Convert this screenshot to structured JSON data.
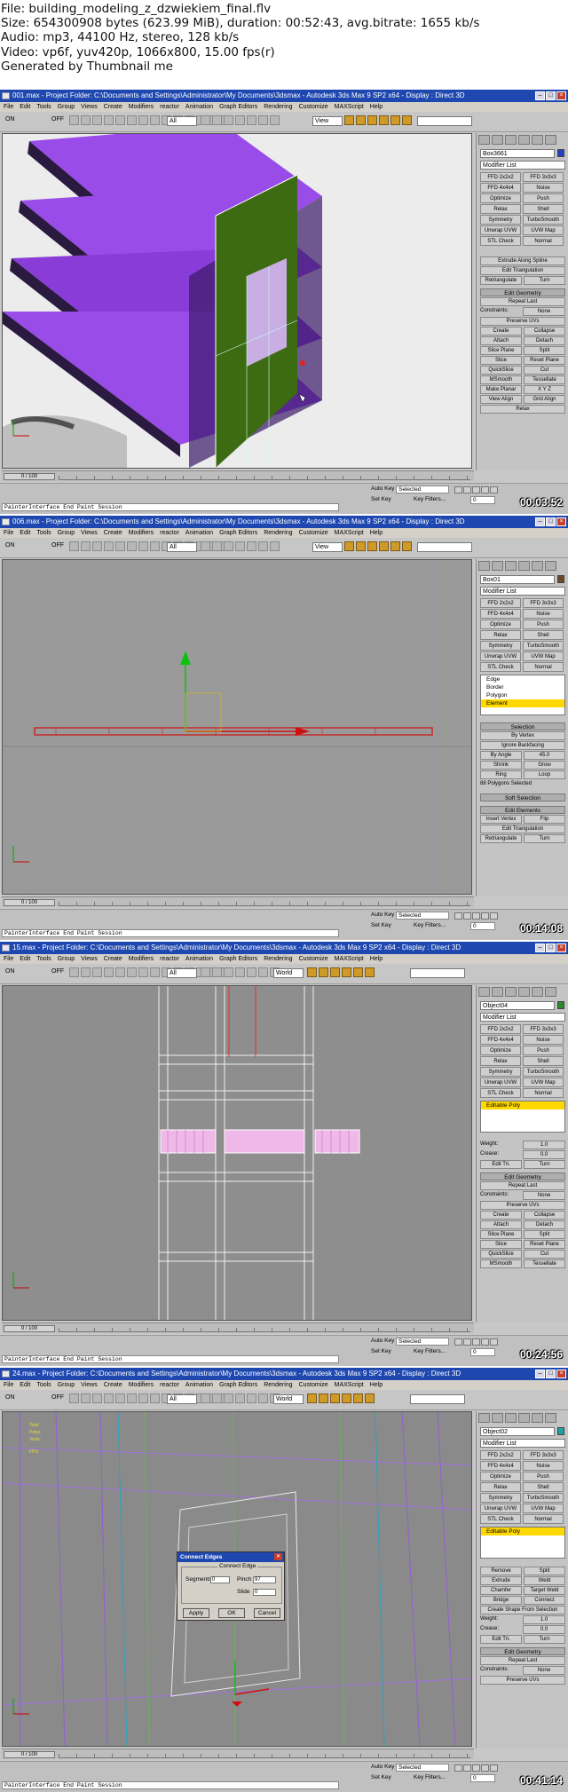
{
  "header": {
    "file": "File: building_modeling_z_dzwiekiem_final.flv",
    "size": "Size: 654300908 bytes (623.99 MiB), duration: 00:52:43, avg.bitrate: 1655 kb/s",
    "audio": "Audio: mp3, 44100 Hz, stereo, 128 kb/s",
    "video": "Video: vp6f, yuv420p, 1066x800, 15.00 fps(r)",
    "generated": "Generated by Thumbnail me"
  },
  "ui": {
    "app_title": "Autodesk 3ds Max 9 SP2 x64",
    "project_folder": "Project Folder: C:\\Documents and Settings\\Administrator\\My Documents\\3dsmax",
    "display": "- Display : Direct 3D",
    "menu": [
      "File",
      "Edit",
      "Tools",
      "Group",
      "Views",
      "Create",
      "Modifiers",
      "reactor",
      "Animation",
      "Graph Editors",
      "Rendering",
      "Customize",
      "MAXScript",
      "Help"
    ],
    "undo": "ON",
    "redo": "OFF",
    "filter_all": "All",
    "view": "View",
    "world": "World",
    "modifier_list": "Modifier List",
    "modifiers": [
      "FFD 2x2x2",
      "FFD 3x3x3",
      "FFD 4x4x4",
      "Noise",
      "Optimize",
      "Push",
      "Relax",
      "Shell",
      "Symmetry",
      "TurboSmooth",
      "Unwrap UVW",
      "UVW Map",
      "STL Check",
      "Normal"
    ],
    "timeline": "0 / 100",
    "status_text": "PainterInterface End Paint Session",
    "auto_key": "Auto Key",
    "set_key": "Set Key",
    "selected": "Selected",
    "key_filters": "Key Filters...",
    "frame_value": "0"
  },
  "frames": [
    {
      "file": "001.max",
      "timestamp": "00:03:52",
      "object_name": "Box3661",
      "object_color": "#2040c0",
      "rollouts": [
        {
          "head": "",
          "rows": [
            [
              "Extrude Along Spline"
            ],
            [
              "Edit Triangulation"
            ],
            [
              "Retriangulate",
              "Turn"
            ]
          ]
        },
        {
          "head": "Edit Geometry",
          "rows": [
            [
              "Repeat Last"
            ],
            [
              "Constraints:",
              "None"
            ],
            [
              "Preserve UVs"
            ],
            [
              "Create",
              "Collapse"
            ],
            [
              "Attach",
              "Detach"
            ],
            [
              "Slice Plane",
              "Split"
            ],
            [
              "Slice",
              "Reset Plane"
            ],
            [
              "QuickSlice",
              "Cut"
            ],
            [
              "MSmooth",
              "Tessellate"
            ],
            [
              "Make Planar",
              "X Y Z"
            ],
            [
              "View Align",
              "Grid Align"
            ],
            [
              "Relax"
            ]
          ]
        }
      ]
    },
    {
      "file": "006.max",
      "timestamp": "00:14:08",
      "object_name": "Box01",
      "object_color": "#6a4a2a",
      "stack": [
        "Edge",
        "Border",
        "Polygon",
        "Element"
      ],
      "stack_sel": 3,
      "rollouts": [
        {
          "head": "Selection",
          "rows": [
            [
              "By Vertex"
            ],
            [
              "Ignore Backfacing"
            ],
            [
              "By Angle",
              "45.0"
            ],
            [
              "Shrink",
              "Grow"
            ],
            [
              "Ring",
              "Loop"
            ],
            [
              "88 Polygons Selected"
            ]
          ]
        },
        {
          "head": "Soft Selection",
          "rows": []
        },
        {
          "head": "Edit Elements",
          "rows": [
            [
              "Insert Vertex",
              "Flip"
            ],
            [
              "Edit Triangulation"
            ],
            [
              "Retriangulate",
              "Turn"
            ]
          ]
        }
      ]
    },
    {
      "file": "15.max",
      "timestamp": "00:24:56",
      "object_name": "Object04",
      "object_color": "#2a8a2a",
      "stack": [
        "Editable Poly"
      ],
      "stack_sel": 0,
      "rollouts": [
        {
          "head": "",
          "rows": [
            [
              "Weight:",
              "1.0"
            ],
            [
              "Crease:",
              "0.0"
            ],
            [
              "Edit Tri.",
              "Turn"
            ]
          ]
        },
        {
          "head": "Edit Geometry",
          "rows": [
            [
              "Repeat Last"
            ],
            [
              "Constraints:",
              "None"
            ],
            [
              "Preserve UVs"
            ],
            [
              "Create",
              "Collapse"
            ],
            [
              "Attach",
              "Detach"
            ],
            [
              "Slice Plane",
              "Split"
            ],
            [
              "Slice",
              "Reset Plane"
            ],
            [
              "QuickSlice",
              "Cut"
            ],
            [
              "MSmooth",
              "Tessellate"
            ]
          ]
        }
      ]
    },
    {
      "file": "24.max",
      "timestamp": "00:41:14",
      "object_name": "Object02",
      "object_color": "#20a0a0",
      "stack": [
        "Editable Poly"
      ],
      "stack_sel": 0,
      "dialog": {
        "title": "Connect Edges",
        "group": "Connect Edge",
        "segments_label": "Segments",
        "segments": "0",
        "pinch_label": "Pinch",
        "pinch": "97",
        "slide_label": "Slide",
        "slide": "0",
        "apply": "Apply",
        "ok": "OK",
        "cancel": "Cancel"
      },
      "rollouts": [
        {
          "head": "",
          "rows": [
            [
              "Remove",
              "Split"
            ],
            [
              "Extrude",
              "Weld"
            ],
            [
              "Chamfer",
              "Target Weld"
            ],
            [
              "Bridge",
              "Connect"
            ],
            [
              "Create Shape From Selection"
            ],
            [
              "Weight:",
              "1.0"
            ],
            [
              "Crease:",
              "0.0"
            ],
            [
              "Edit Tri.",
              "Turn"
            ]
          ]
        },
        {
          "head": "Edit Geometry",
          "rows": [
            [
              "Repeat Last"
            ],
            [
              "Constraints:",
              "None"
            ],
            [
              "Preserve UVs"
            ]
          ]
        }
      ]
    }
  ]
}
